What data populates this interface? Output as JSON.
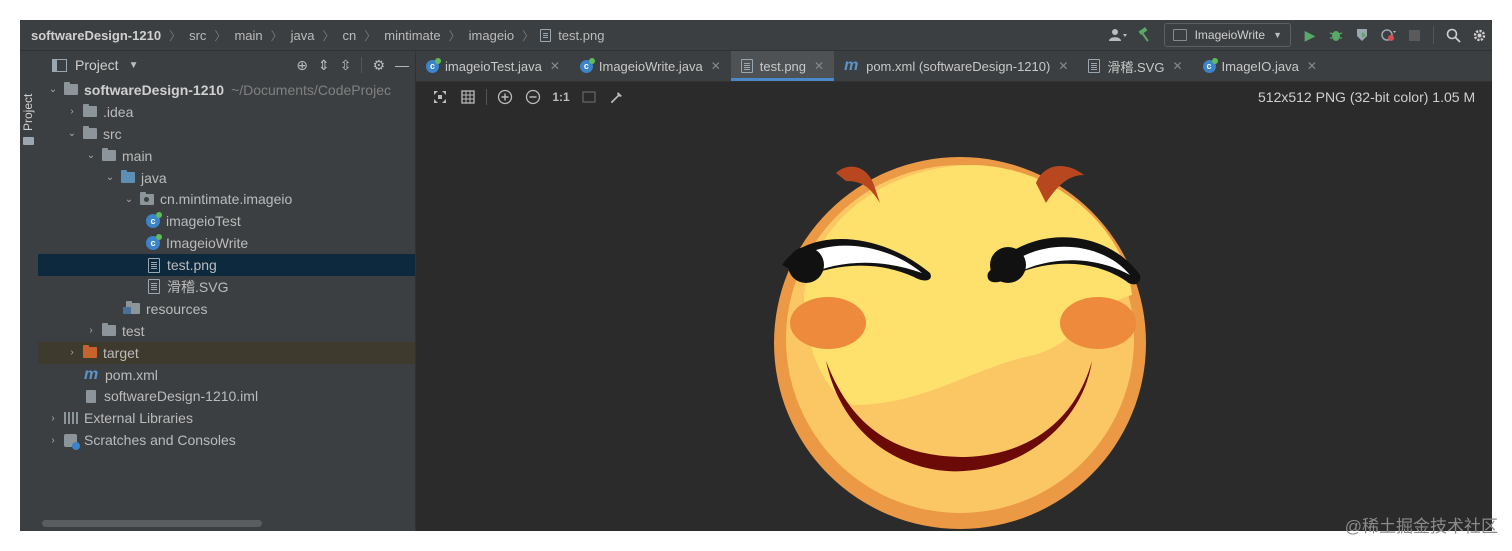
{
  "navbar": {
    "crumbs": [
      "softwareDesign-1210",
      "src",
      "main",
      "java",
      "cn",
      "mintimate",
      "imageio",
      "test.png"
    ],
    "run_config": "ImageioWrite"
  },
  "sidebar_stripe": {
    "label": "Project"
  },
  "project_panel": {
    "title": "Project",
    "tree": [
      {
        "label": "softwareDesign-1210",
        "suffix": "~/Documents/CodeProjec"
      },
      {
        "label": ".idea"
      },
      {
        "label": "src"
      },
      {
        "label": "main"
      },
      {
        "label": "java"
      },
      {
        "label": "cn.mintimate.imageio"
      },
      {
        "label": "imageioTest"
      },
      {
        "label": "ImageioWrite"
      },
      {
        "label": "test.png"
      },
      {
        "label": "滑稽.SVG"
      },
      {
        "label": "resources"
      },
      {
        "label": "test"
      },
      {
        "label": "target"
      },
      {
        "label": "pom.xml"
      },
      {
        "label": "softwareDesign-1210.iml"
      },
      {
        "label": "External Libraries"
      },
      {
        "label": "Scratches and Consoles"
      }
    ]
  },
  "editor": {
    "tabs": [
      {
        "label": "imageioTest.java",
        "active": false
      },
      {
        "label": "ImageioWrite.java",
        "active": false
      },
      {
        "label": "test.png",
        "active": true
      },
      {
        "label": "pom.xml (softwareDesign-1210)",
        "active": false
      },
      {
        "label": "滑稽.SVG",
        "active": false
      },
      {
        "label": "ImageIO.java",
        "active": false
      }
    ],
    "toolbar": {
      "actual_size": "1:1"
    },
    "image_info": "512x512 PNG (32-bit color) 1.05 M"
  },
  "watermark": "@稀土掘金技术社区",
  "colors": {
    "accent": "#4a88c7",
    "selection": "#0d293e",
    "run_green": "#59a869"
  }
}
